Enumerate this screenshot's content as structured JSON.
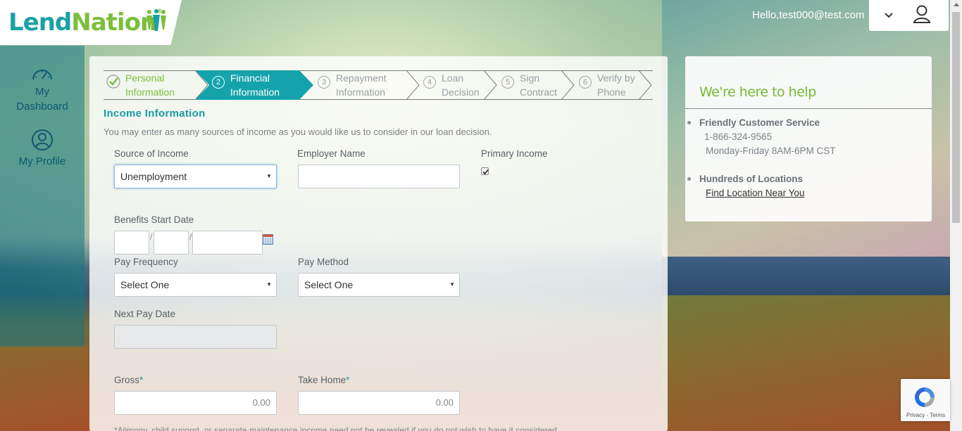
{
  "brand": {
    "logo_lend": "Lend",
    "logo_nation": "Nation",
    "logo_reg": "®"
  },
  "header": {
    "greeting": "Hello,test000@test.com",
    "menu_icon": "chevron-down-icon",
    "user_icon": "user-icon"
  },
  "nav": {
    "items": [
      {
        "label_line1": "My",
        "label_line2": "Dashboard",
        "icon": "speedometer-icon"
      },
      {
        "label": "My Profile",
        "icon": "profile-icon"
      }
    ]
  },
  "steps": [
    {
      "num": "✓",
      "line1": "Personal",
      "line2": "Information",
      "state": "done"
    },
    {
      "num": "2",
      "line1": "Financial",
      "line2": "Information",
      "state": "active"
    },
    {
      "num": "3",
      "line1": "Repayment",
      "line2": "Information",
      "state": "todo"
    },
    {
      "num": "4",
      "line1": "Loan",
      "line2": "Decision",
      "state": "todo"
    },
    {
      "num": "5",
      "line1": "Sign",
      "line2": "Contract",
      "state": "todo"
    },
    {
      "num": "6",
      "line1": "Verify by",
      "line2": "Phone",
      "state": "todo"
    }
  ],
  "form": {
    "section_title": "Income Information",
    "hint": "You may enter as many sources of income as you would like us to consider in our loan decision.",
    "source_label": "Source of Income",
    "source_value": "Unemployment",
    "employer_label": "Employer Name",
    "employer_value": "",
    "primary_label": "Primary Income",
    "primary_checked": true,
    "benefits_label": "Benefits Start Date",
    "date_sep": "/",
    "calendar_icon": "calendar-icon",
    "pay_freq_label": "Pay Frequency",
    "pay_freq_value": "Select One",
    "pay_method_label": "Pay Method",
    "pay_method_value": "Select One",
    "next_pay_label": "Next Pay Date",
    "next_pay_value": "",
    "gross_label": "Gross",
    "gross_value": "0.00",
    "take_home_label": "Take Home",
    "take_home_value": "0.00",
    "required_mark": "*",
    "footnote": "*Alimony, child support, or separate maintenance income need not be revealed if you do not wish to have it considered"
  },
  "help": {
    "title": "We're here to help",
    "service_heading": "Friendly Customer Service",
    "phone": "1-866-324-9565",
    "hours": "Monday-Friday 8AM-6PM CST",
    "locations_heading": "Hundreds of Locations",
    "find_link": "Find  Location  Near You"
  },
  "recaptcha": {
    "links": "Privacy - Terms"
  },
  "colors": {
    "teal": "#14a3ab",
    "green": "#78b833",
    "card": "#ffffff"
  }
}
